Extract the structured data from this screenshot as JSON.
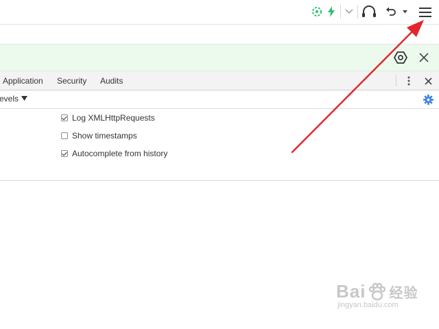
{
  "toolbar": {
    "icons": [
      "aperture-icon",
      "lightning-icon",
      "chevron-down-icon",
      "headphones-icon",
      "undo-icon",
      "dropdown-caret-icon",
      "hamburger-menu-icon"
    ],
    "accent_color": "#2fbf71"
  },
  "devtools": {
    "tabs": [
      {
        "label": "Application"
      },
      {
        "label": "Security"
      },
      {
        "label": "Audits"
      }
    ],
    "console": {
      "levels_label": "evels"
    },
    "settings": {
      "options": [
        {
          "label": "Log XMLHttpRequests",
          "checked": true
        },
        {
          "label": "Show timestamps",
          "checked": false
        },
        {
          "label": "Autocomplete from history",
          "checked": true
        }
      ]
    },
    "gear_color": "#3b82e6"
  },
  "annotation": {
    "arrow_color": "#e3262b"
  },
  "watermark": {
    "brand": "Bai",
    "brand2": "经验",
    "url": "jingyan.baidu.com"
  }
}
